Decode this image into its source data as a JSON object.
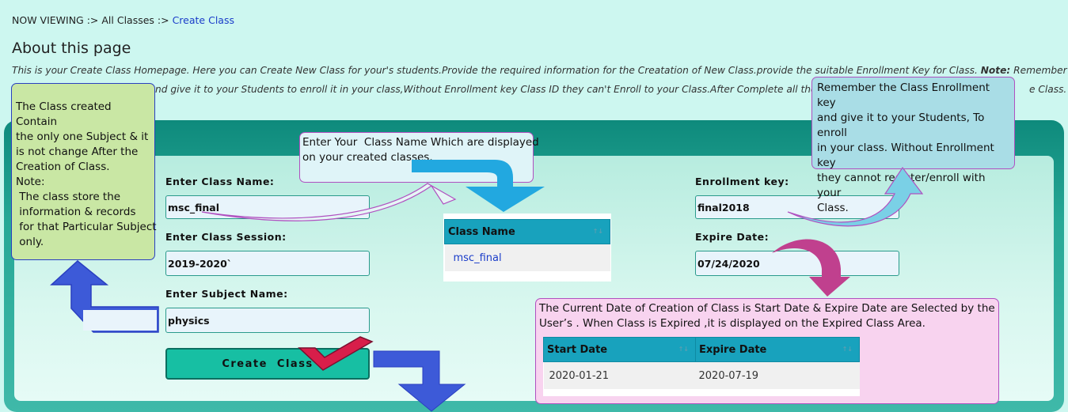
{
  "breadcrumb": {
    "prefix": "NOW VIEWING :> All Classes :> ",
    "current": "Create Class"
  },
  "about": {
    "title": "About this page",
    "line1_a": "This is your Create Class Homepage. Here you can Create New Class for your's students.Provide the required information for the Creatation of New Class.provide the suitable Enrollment Key for Class. ",
    "line1_note": "Note:",
    "line1_b": " Remember the",
    "line2": "nd give it to your Students to enroll it in your class,Without Enrollment key Class ID they can't Enroll to your Class.After Complete all the r",
    "line2_end": "e Class."
  },
  "form": {
    "class_name_label": "Enter Class Name:",
    "class_name_value": "msc_final",
    "session_label": "Enter Class Session:",
    "session_value": "2019-2020`",
    "subject_label": "Enter Subject Name:",
    "subject_value": "physics",
    "enroll_label": "Enrollment key:",
    "enroll_value": "final2018",
    "expire_label": "Expire Date:",
    "expire_value": "07/24/2020",
    "create_button": "Create Class"
  },
  "class_table": {
    "header": "Class Name",
    "rows": [
      "msc_final"
    ]
  },
  "date_table": {
    "headers": [
      "Start Date",
      "Expire Date"
    ],
    "rows": [
      [
        "2020-01-21",
        "2020-07-19"
      ]
    ]
  },
  "callouts": {
    "left": [
      "The Class created Contain",
      "the only one Subject & it",
      "is not change  After the",
      "Creation of Class.",
      "Note:",
      " The class store the",
      " information & records",
      " for that Particular Subject",
      " only."
    ],
    "enroll": [
      "Remember the Class Enrollment key",
      "and give it to your Students, To enroll",
      "in your class. Without Enrollment key",
      "they cannot register/enroll with your",
      "Class."
    ],
    "classname": [
      "Enter Your  Class Name Which are displayed",
      "on your created classes."
    ],
    "date": [
      "The Current Date of Creation of Class is Start Date & Expire Date are Selected by the",
      "User’s . When Class is Expired ,it is displayed on the Expired Class Area."
    ]
  },
  "colors": {
    "page_bg": "#cdf7f0",
    "panel": "#27a896",
    "button": "#17bfa3",
    "table_header": "#18a2bd",
    "link": "#1a3cc9"
  }
}
